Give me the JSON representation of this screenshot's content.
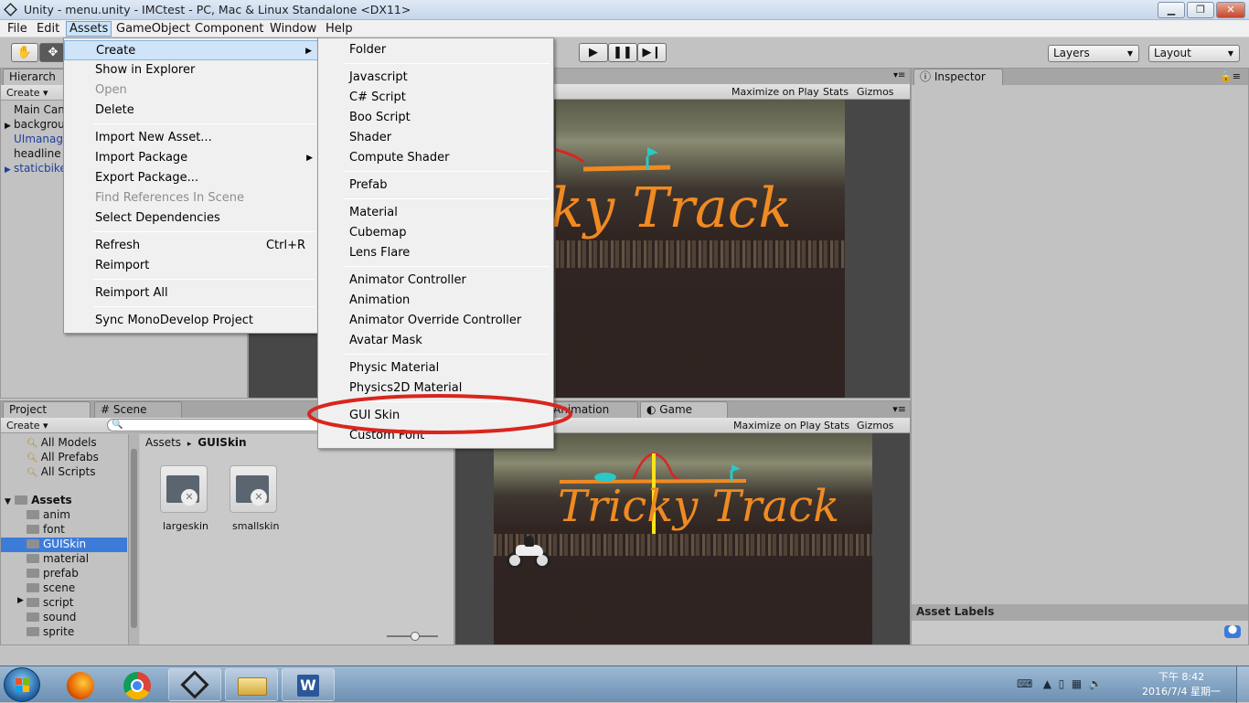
{
  "window": {
    "title": "Unity - menu.unity - IMCtest - PC, Mac & Linux Standalone <DX11>",
    "controls": {
      "minimize": "▁",
      "maximize": "❐",
      "close": "✕"
    }
  },
  "menubar": [
    "File",
    "Edit",
    "Assets",
    "GameObject",
    "Component",
    "Window",
    "Help"
  ],
  "toolbar": {
    "play": "▶",
    "pause": "❚❚",
    "step": "▶❙",
    "layers": "Layers",
    "layout": "Layout"
  },
  "hierarchy": {
    "tab": "Hierarch",
    "create": "Create",
    "items": [
      {
        "label": "Main Cam",
        "color": "#111111",
        "expandable": false
      },
      {
        "label": "backgrou",
        "color": "#111111",
        "expandable": true
      },
      {
        "label": "UImanag",
        "color": "#1f3f9a",
        "expandable": false
      },
      {
        "label": "headline",
        "color": "#111111",
        "expandable": false
      },
      {
        "label": "staticbike",
        "color": "#1f3f9a",
        "expandable": true
      }
    ]
  },
  "scene_top": {
    "maximize": "Maximize on Play",
    "stats": "Stats",
    "gizmos": "Gizmos",
    "logo_partial": "ky Track"
  },
  "inspector": {
    "tab": "Inspector",
    "asset_labels": "Asset Labels"
  },
  "project": {
    "tab": "Project",
    "scene_tab": "Scene",
    "create": "Create",
    "search_placeholder": "",
    "favorites": [
      "All Models",
      "All Prefabs",
      "All Scripts"
    ],
    "root": "Assets",
    "folders": [
      "anim",
      "font",
      "GUISkin",
      "material",
      "prefab",
      "scene",
      "script",
      "sound",
      "sprite"
    ],
    "selected_folder": "GUISkin",
    "breadcrumb_root": "Assets",
    "breadcrumb_sep": "▸",
    "breadcrumb_current": "GUISkin",
    "assets": [
      "largeskin",
      "smallskin"
    ]
  },
  "game": {
    "animation_tab": "Animation",
    "game_tab": "Game",
    "maximize": "Maximize on Play",
    "stats": "Stats",
    "gizmos": "Gizmos",
    "logo": "Tricky Track"
  },
  "assets_menu": {
    "items": [
      {
        "label": "Create",
        "submenu": true,
        "highlight": true
      },
      {
        "label": "Show in Explorer"
      },
      {
        "label": "Open",
        "disabled": true
      },
      {
        "label": "Delete"
      },
      {
        "sep": true
      },
      {
        "label": "Import New Asset..."
      },
      {
        "label": "Import Package",
        "submenu": true
      },
      {
        "label": "Export Package..."
      },
      {
        "label": "Find References In Scene",
        "disabled": true
      },
      {
        "label": "Select Dependencies"
      },
      {
        "sep": true
      },
      {
        "label": "Refresh",
        "shortcut": "Ctrl+R"
      },
      {
        "label": "Reimport"
      },
      {
        "sep": true
      },
      {
        "label": "Reimport All"
      },
      {
        "sep": true
      },
      {
        "label": "Sync MonoDevelop Project"
      }
    ]
  },
  "create_menu": {
    "items": [
      {
        "label": "Folder"
      },
      {
        "sep": true
      },
      {
        "label": "Javascript"
      },
      {
        "label": "C# Script"
      },
      {
        "label": "Boo Script"
      },
      {
        "label": "Shader"
      },
      {
        "label": "Compute Shader"
      },
      {
        "sep": true
      },
      {
        "label": "Prefab"
      },
      {
        "sep": true
      },
      {
        "label": "Material"
      },
      {
        "label": "Cubemap"
      },
      {
        "label": "Lens Flare"
      },
      {
        "sep": true
      },
      {
        "label": "Animator Controller"
      },
      {
        "label": "Animation"
      },
      {
        "label": "Animator Override Controller"
      },
      {
        "label": "Avatar Mask"
      },
      {
        "sep": true
      },
      {
        "label": "Physic Material"
      },
      {
        "label": "Physics2D Material"
      },
      {
        "sep": true
      },
      {
        "label": "GUI Skin",
        "circled": true
      },
      {
        "label": "Custom Font"
      }
    ]
  },
  "taskbar": {
    "clock_time": "下午 8:42",
    "clock_date": "2016/7/4 星期一",
    "apps": [
      "start-orb",
      "firefox",
      "chrome",
      "unity",
      "explorer",
      "word"
    ]
  },
  "colors": {
    "selection": "#3d7bd9",
    "circle": "#d8261f",
    "logo_orange": "#f08a22"
  }
}
